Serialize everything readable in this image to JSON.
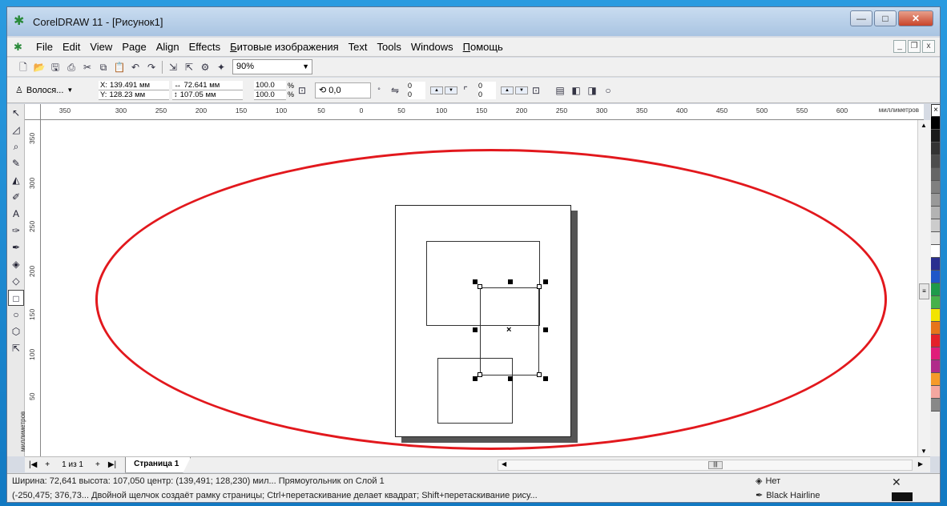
{
  "window": {
    "title": "CorelDRAW 11 - [Рисунок1]",
    "controls": {
      "minimize": "—",
      "maximize": "□",
      "close": "✕"
    }
  },
  "menu": {
    "items": [
      "File",
      "Edit",
      "View",
      "Page",
      "Align",
      "Effects",
      "Битовые изображения",
      "Text",
      "Tools",
      "Windows",
      "Помощь"
    ],
    "mdi": {
      "minimize": "_",
      "restore": "❐",
      "close": "x"
    }
  },
  "toolbar": {
    "zoom": "90%"
  },
  "property_bar": {
    "preset_label": "Волося...",
    "x": "139.491 мм",
    "y": "128.23 мм",
    "x_label": "X:",
    "y_label": "Y:",
    "width": "72.641 мм",
    "height": "107.05 мм",
    "scale_w": "100.0",
    "scale_h": "100.0",
    "pct": "%",
    "angle": "0,0",
    "corner_values": [
      "0",
      "0",
      "0",
      "0"
    ]
  },
  "rulers": {
    "top_ticks": [
      "350",
      "300",
      "250",
      "200",
      "150",
      "100",
      "50",
      "0",
      "50",
      "100",
      "150",
      "200",
      "250",
      "300",
      "350",
      "400",
      "450",
      "500",
      "550",
      "600"
    ],
    "top_unit": "миллиметров",
    "left_ticks": [
      "350",
      "300",
      "250",
      "200",
      "150",
      "100",
      "50"
    ],
    "left_unit": "миллиметров"
  },
  "page_nav": {
    "count": "1 из 1",
    "tab": "Страница 1"
  },
  "status": {
    "line1": "Ширина: 72,641  высота: 107,050  центр: (139,491; 128,230)  мил...   Прямоугольник on Слой 1",
    "line2": "(-250,475; 376,73...  Двойной щелчок создаёт рамку страницы; Ctrl+перетаскивание делает квадрат; Shift+перетаскивание рису...",
    "fill": "Нет",
    "outline": "Black  Hairline"
  },
  "palette": [
    "#000000",
    "#1a1a1a",
    "#333333",
    "#4d4d4d",
    "#666666",
    "#808080",
    "#999999",
    "#b3b3b3",
    "#cccccc",
    "#e6e6e6",
    "#ffffff",
    "#2a2f8f",
    "#1f57c8",
    "#1e9a4a",
    "#46b14a",
    "#f2e400",
    "#e6741a",
    "#e4202a",
    "#e01d7a",
    "#b02a8a",
    "#f59a2a",
    "#f4a7a0",
    "#888888"
  ],
  "accent": {
    "ellipse": "#e2181d",
    "title_bg": "#b8cfe8"
  }
}
